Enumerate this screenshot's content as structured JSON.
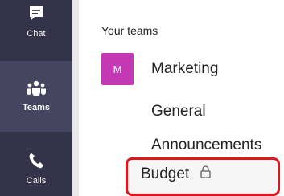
{
  "rail": {
    "items": [
      {
        "label": "Chat",
        "icon": "chat-icon"
      },
      {
        "label": "Teams",
        "icon": "teams-icon"
      },
      {
        "label": "Calls",
        "icon": "calls-icon"
      }
    ],
    "active": "Teams"
  },
  "panel": {
    "section_title": "Your teams",
    "team": {
      "avatar_letter": "M",
      "name": "Marketing",
      "avatar_color": "#c239b3"
    },
    "channels": [
      {
        "name": "General"
      },
      {
        "name": "Announcements"
      },
      {
        "name": "Budget",
        "private": true,
        "selected": true
      }
    ]
  },
  "colors": {
    "rail": "#33344a",
    "highlight": "#e0161a",
    "accent": "#c239b3"
  }
}
